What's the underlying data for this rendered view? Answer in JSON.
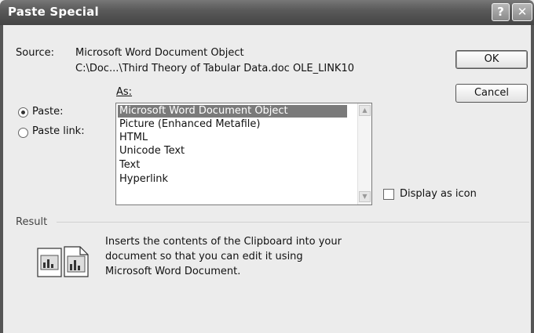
{
  "window": {
    "title": "Paste Special",
    "help_glyph": "?",
    "close_glyph": "✕"
  },
  "source": {
    "label": "Source:",
    "line1": "Microsoft Word Document Object",
    "line2": "C:\\Doc...\\Third Theory of Tabular Data.doc OLE_LINK10"
  },
  "as_label": "As:",
  "options": {
    "paste_label": "Paste:",
    "paste_link_label": "Paste link:",
    "selected": "paste"
  },
  "as_list": {
    "items": [
      "Microsoft Word Document Object",
      "Picture (Enhanced Metafile)",
      "HTML",
      "Unicode Text",
      "Text",
      "Hyperlink"
    ],
    "selected_index": 0
  },
  "display_as_icon": {
    "label": "Display as icon",
    "checked": false
  },
  "result": {
    "label": "Result",
    "line1": "Inserts the contents of the Clipboard into your",
    "line2": "document so that you can edit it using",
    "line3": "Microsoft Word Document."
  },
  "buttons": {
    "ok": "OK",
    "cancel": "Cancel"
  },
  "icons": {
    "help": "help-icon",
    "close": "close-icon",
    "result": "paste-document-icon",
    "scroll_up": "scroll-up-arrow-icon",
    "scroll_down": "scroll-down-arrow-icon"
  },
  "colors": {
    "title_bar": "#555555",
    "selection": "#7a7a7a",
    "dialog_bg": "#ececec"
  }
}
